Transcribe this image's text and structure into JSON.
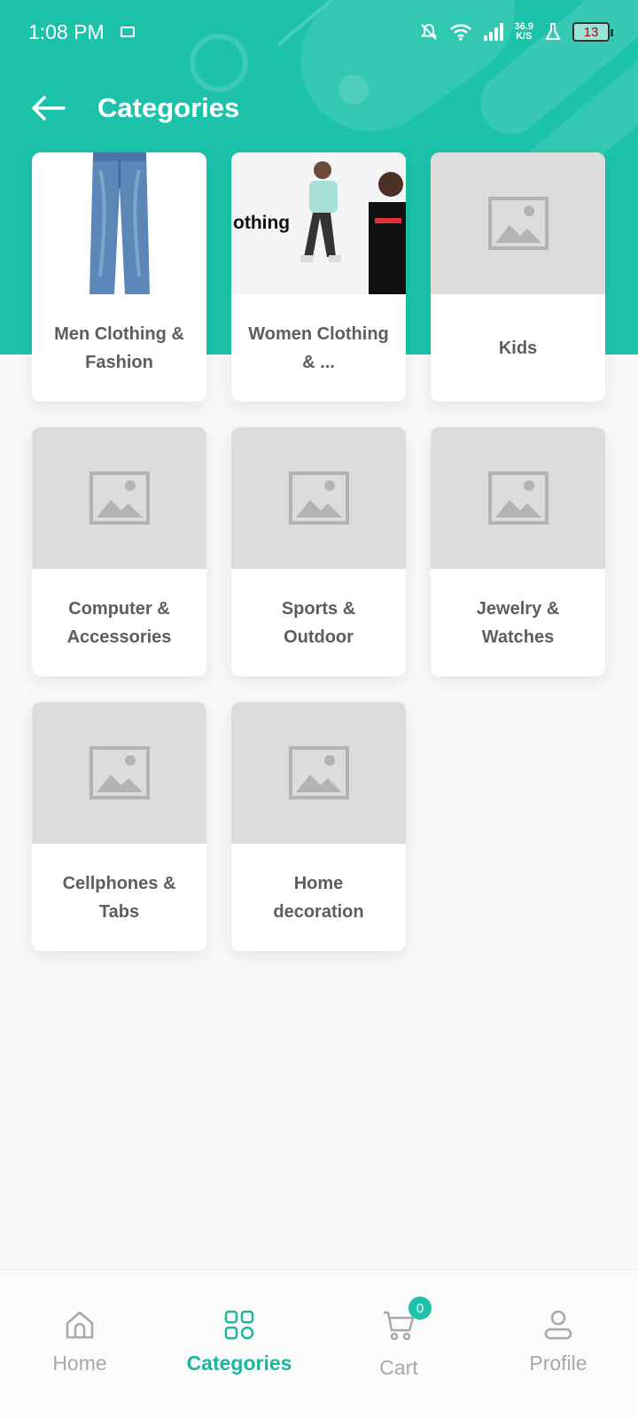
{
  "status_bar": {
    "time": "1:08 PM",
    "speed_value": "36.9",
    "speed_unit": "K/S",
    "battery": "13"
  },
  "app_bar": {
    "title": "Categories"
  },
  "categories": [
    {
      "label": "Men Clothing & Fashion",
      "image": "jeans"
    },
    {
      "label": "Women Clothing & ...",
      "image": "women-photo",
      "image_text": "othing"
    },
    {
      "label": "Kids",
      "image": "placeholder"
    },
    {
      "label": "Computer & Accessories",
      "image": "placeholder"
    },
    {
      "label": "Sports & Outdoor",
      "image": "placeholder"
    },
    {
      "label": "Jewelry & Watches",
      "image": "placeholder"
    },
    {
      "label": "Cellphones & Tabs",
      "image": "placeholder"
    },
    {
      "label": "Home decoration",
      "image": "placeholder"
    }
  ],
  "bottom_nav": {
    "home": "Home",
    "categories": "Categories",
    "cart": "Cart",
    "cart_count": "0",
    "profile": "Profile"
  },
  "colors": {
    "accent": "#1cc2aa",
    "active_nav": "#1cb6a0",
    "placeholder_bg": "#dcdcdc"
  }
}
